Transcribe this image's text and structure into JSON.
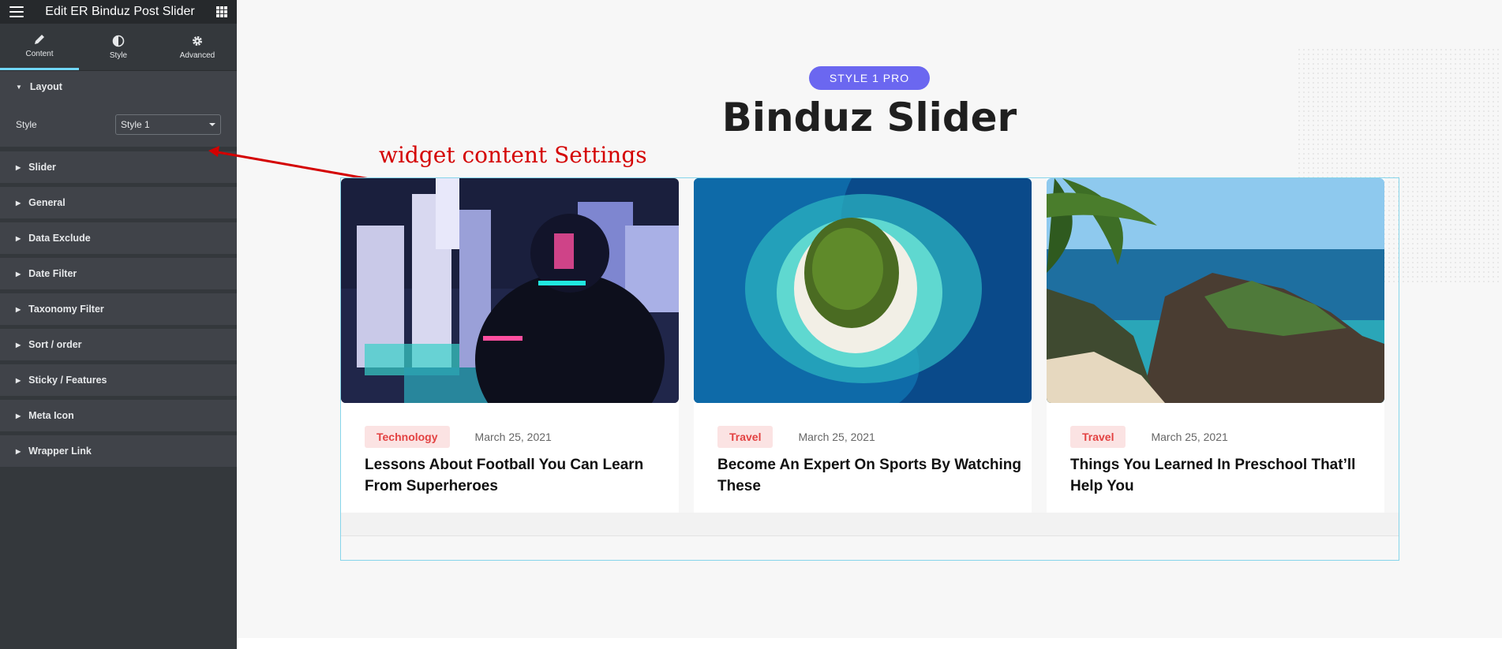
{
  "sidebar": {
    "header_title": "Edit ER Binduz Post Slider",
    "tabs": [
      {
        "label": "Content",
        "icon": "pencil-icon",
        "active": true
      },
      {
        "label": "Style",
        "icon": "half-circle-icon",
        "active": false
      },
      {
        "label": "Advanced",
        "icon": "gear-icon",
        "active": false
      }
    ],
    "layout": {
      "label": "Layout",
      "style_label": "Style",
      "style_value": "Style 1"
    },
    "sections": [
      "Slider",
      "General",
      "Data Exclude",
      "Date Filter",
      "Taxonomy Filter",
      "Sort / order",
      "Sticky / Features",
      "Meta Icon",
      "Wrapper Link"
    ]
  },
  "preview": {
    "badge": "STYLE 1 PRO",
    "title": "Binduz Slider",
    "annotation": "widget content Settings",
    "cards": [
      {
        "tag": "Technology",
        "date": "March 25, 2021",
        "title": "Lessons About Football You Can Learn From Superheroes",
        "image": "neon-city-person"
      },
      {
        "tag": "Travel",
        "date": "March 25, 2021",
        "title": "Become An Expert On Sports By Watching These",
        "image": "island-aerial"
      },
      {
        "tag": "Travel",
        "date": "March 25, 2021",
        "title": "Things You Learned In Preschool That’ll Help You",
        "image": "coastal-cliffs"
      }
    ]
  },
  "colors": {
    "sidebar_bg": "#34383c",
    "active_tab_accent": "#71d7f7",
    "badge_bg": "#6b67f0",
    "tag_text": "#e34242",
    "annotation": "#d40000"
  }
}
